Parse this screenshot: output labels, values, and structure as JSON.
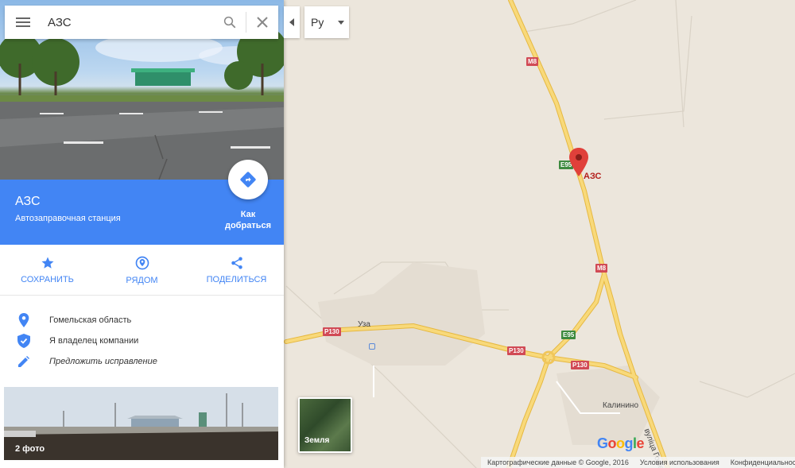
{
  "search": {
    "value": "АЗС",
    "placeholder": ""
  },
  "language": {
    "selected": "Ру"
  },
  "place": {
    "title": "АЗС",
    "subtitle": "Автозаправочная станция",
    "directions_label": "Как добраться"
  },
  "actions": [
    {
      "label": "СОХРАНИТЬ",
      "icon": "star-icon"
    },
    {
      "label": "РЯДОМ",
      "icon": "nearby-icon"
    },
    {
      "label": "ПОДЕЛИТЬСЯ",
      "icon": "share-icon"
    }
  ],
  "info": [
    {
      "text": "Гомельская область",
      "icon": "location-pin-icon"
    },
    {
      "text": "Я владелец компании",
      "icon": "verified-shield-icon"
    },
    {
      "text": "Предложить исправление",
      "icon": "edit-pencil-icon"
    }
  ],
  "photos": {
    "count_label": "2 фото"
  },
  "map": {
    "pin_label": "АЗС",
    "place_labels": {
      "uza": "Уза",
      "kalinino": "Калинино",
      "street": "вуліца Гомел"
    },
    "shields": {
      "m8": "M8",
      "e95": "E95",
      "p130": "P130"
    },
    "earth_label": "Земля",
    "google_letters": [
      "G",
      "o",
      "o",
      "g",
      "l",
      "e"
    ],
    "footer": [
      "Картографические данные © Google, 2016",
      "Условия использования",
      "Конфиденциальность"
    ]
  },
  "colors": {
    "accent": "#4285f4",
    "map_background": "#ece6dc",
    "road_major": "#f5d26b",
    "pin": "#e0403a"
  }
}
